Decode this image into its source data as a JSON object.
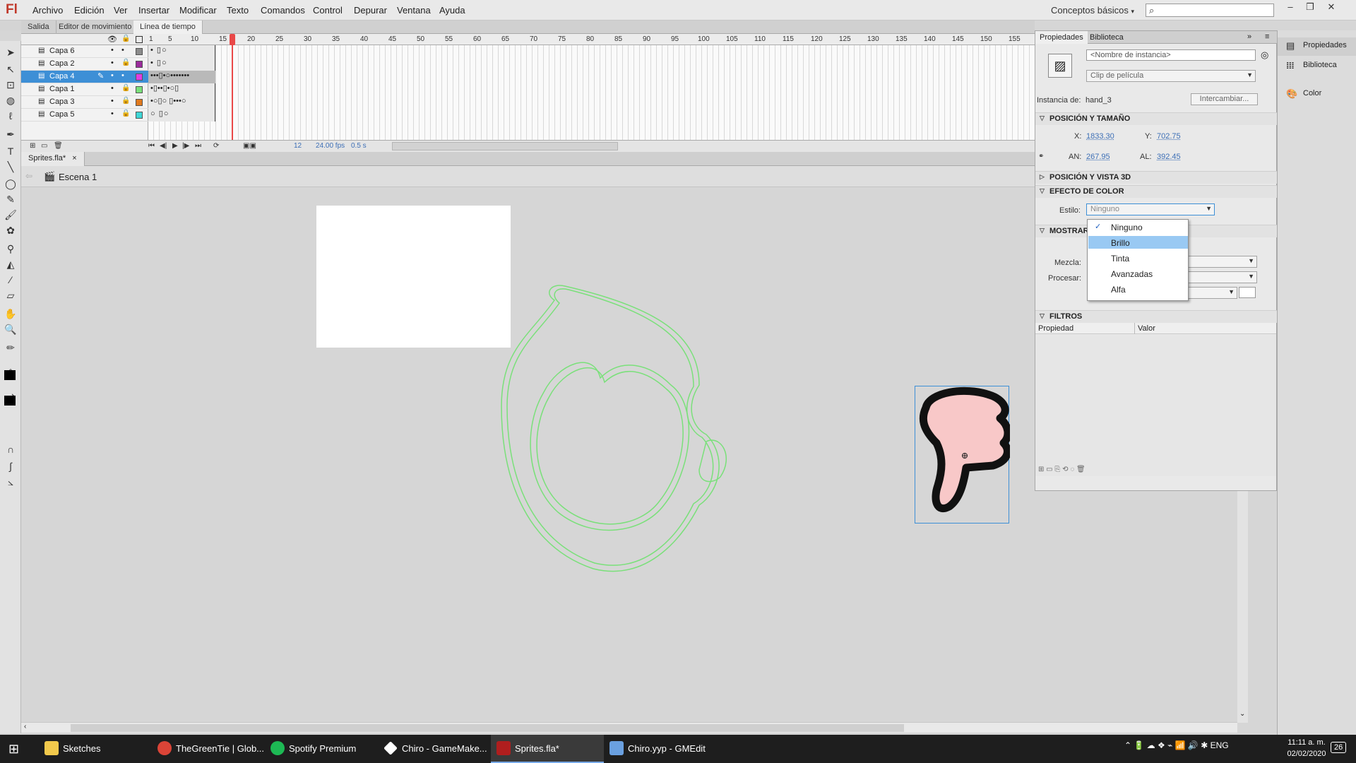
{
  "app": {
    "logo": "Fl",
    "workspace": "Conceptos básicos",
    "workspace_arrow": "▾"
  },
  "menu": [
    "Archivo",
    "Edición",
    "Ver",
    "Insertar",
    "Modificar",
    "Texto",
    "Comandos",
    "Control",
    "Depurar",
    "Ventana",
    "Ayuda"
  ],
  "panel_tabs": [
    "Salida",
    "Editor de movimiento",
    "Línea de tiempo"
  ],
  "layers": [
    {
      "name": "Capa 6",
      "color": "#8c8c8c"
    },
    {
      "name": "Capa 2",
      "color": "#9b2c9b"
    },
    {
      "name": "Capa 4",
      "color": "#e23ce2",
      "selected": true
    },
    {
      "name": "Capa 1",
      "color": "#7ae07a"
    },
    {
      "name": "Capa 3",
      "color": "#e07a1f"
    },
    {
      "name": "Capa 5",
      "color": "#3fd6d6"
    }
  ],
  "ruler": [
    "1",
    "5",
    "10",
    "15",
    "20",
    "25",
    "30",
    "35",
    "40",
    "45",
    "50",
    "55",
    "60",
    "65",
    "70",
    "75",
    "80",
    "85",
    "90",
    "95",
    "100",
    "105",
    "110",
    "115",
    "120",
    "125",
    "130",
    "135",
    "140",
    "145",
    "150",
    "155"
  ],
  "timeline_status": {
    "frame": "12",
    "fps": "24.00 fps",
    "time": "0.5 s"
  },
  "document": {
    "tab": "Sprites.fla*",
    "close": "×",
    "scene": "Escena 1"
  },
  "properties": {
    "tabs": [
      "Propiedades",
      "Biblioteca"
    ],
    "instance_name_placeholder": "<Nombre de instancia>",
    "symbol_type": "Clip de película",
    "instance_of_label": "Instancia de:",
    "instance_of": "hand_3",
    "swap_button": "Intercambiar...",
    "sections": {
      "pos_size": "POSICIÓN Y TAMAÑO",
      "pos3d": "POSICIÓN Y VISTA 3D",
      "color_effect": "EFECTO DE COLOR",
      "display": "MOSTRAR",
      "filters": "FILTROS"
    },
    "x_label": "X:",
    "x": "1833.30",
    "y_label": "Y:",
    "y": "702.75",
    "w_label": "AN:",
    "w": "267.95",
    "h_label": "AL:",
    "h": "392.45",
    "style_label": "Estilo:",
    "style_value": "Ninguno",
    "blend_label": "Mezcla:",
    "render_label": "Procesar:",
    "filter_cols": [
      "Propiedad",
      "Valor"
    ]
  },
  "style_dropdown": {
    "items": [
      "Ninguno",
      "Brillo",
      "Tinta",
      "Avanzadas",
      "Alfa"
    ],
    "checked": "Ninguno",
    "highlighted": "Brillo"
  },
  "dock": [
    "Propiedades",
    "Biblioteca",
    "Color"
  ],
  "taskbar": {
    "apps": [
      {
        "label": "Sketches",
        "color": "#f2c94c"
      },
      {
        "label": "TheGreenTie | Glob...",
        "color": "#db4437"
      },
      {
        "label": "Spotify Premium",
        "color": "#1db954"
      },
      {
        "label": "Chiro - GameMake...",
        "color": "#ffffff"
      },
      {
        "label": "Sprites.fla*",
        "color": "#b01e1e"
      },
      {
        "label": "Chiro.yyp - GMEdit",
        "color": "#6aa0e0"
      }
    ],
    "lang": "ENG",
    "time": "11:11 a. m.",
    "date": "02/02/2020",
    "notif": "26"
  },
  "colors": {
    "selection": "#3d8fd6",
    "onion": "#7ae07a",
    "hand_fill": "#f8c8c8"
  }
}
